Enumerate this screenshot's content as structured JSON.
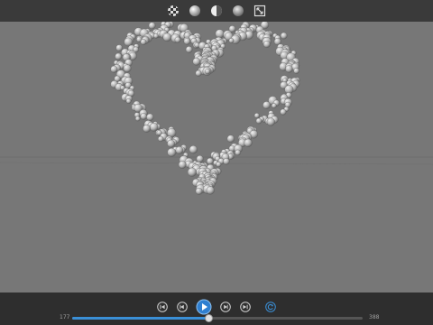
{
  "toolbar": {
    "icons": [
      "checker-material-icon",
      "sphere-material-icon",
      "half-lit-sphere-icon",
      "shaded-sphere-icon",
      "expand-view-icon"
    ]
  },
  "viewport": {
    "background": "#777777",
    "particle_color": "#c8c8c8"
  },
  "playback": {
    "controls": [
      "skip-to-start-icon",
      "step-back-icon",
      "play-icon",
      "step-forward-icon",
      "skip-to-end-icon",
      "loop-icon"
    ],
    "start_frame": "177",
    "end_frame": "388",
    "progress": 0.47,
    "accent": "#3a8fd6"
  }
}
